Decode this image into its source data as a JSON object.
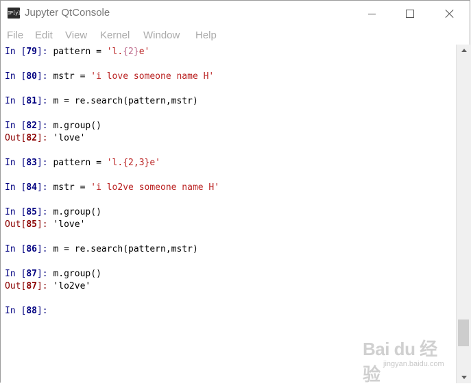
{
  "window": {
    "title": "Jupyter QtConsole",
    "icon_label": "IP[y]"
  },
  "menu": [
    "File",
    "Edit",
    "View",
    "Kernel",
    "Window",
    "Help"
  ],
  "console": [
    {
      "type": "in",
      "n": "79",
      "code": [
        {
          "t": "pattern = "
        },
        {
          "t": "'l.",
          "c": "str"
        },
        {
          "t": "{2}",
          "c": "pat"
        },
        {
          "t": "e'",
          "c": "str"
        }
      ]
    },
    {
      "type": "in",
      "n": "80",
      "code": [
        {
          "t": "mstr = "
        },
        {
          "t": "'i love someone name H'",
          "c": "str"
        }
      ]
    },
    {
      "type": "in",
      "n": "81",
      "code": [
        {
          "t": "m = re.search(pattern,mstr)"
        }
      ]
    },
    {
      "type": "in",
      "n": "82",
      "code": [
        {
          "t": "m.group()"
        }
      ]
    },
    {
      "type": "out",
      "n": "82",
      "code": [
        {
          "t": "'love'"
        }
      ]
    },
    {
      "type": "in",
      "n": "83",
      "code": [
        {
          "t": "pattern = "
        },
        {
          "t": "'l.{2,3}e'",
          "c": "str"
        }
      ]
    },
    {
      "type": "in",
      "n": "84",
      "code": [
        {
          "t": "mstr = "
        },
        {
          "t": "'i lo2ve someone name H'",
          "c": "str"
        }
      ]
    },
    {
      "type": "in",
      "n": "85",
      "code": [
        {
          "t": "m.group()"
        }
      ]
    },
    {
      "type": "out",
      "n": "85",
      "code": [
        {
          "t": "'love'"
        }
      ]
    },
    {
      "type": "in",
      "n": "86",
      "code": [
        {
          "t": "m = re.search(pattern,mstr)"
        }
      ]
    },
    {
      "type": "in",
      "n": "87",
      "code": [
        {
          "t": "m.group()"
        }
      ]
    },
    {
      "type": "out",
      "n": "87",
      "code": [
        {
          "t": "'lo2ve'"
        }
      ]
    },
    {
      "type": "in",
      "n": "88",
      "code": []
    }
  ],
  "watermark": {
    "logo": "Bai du 经验",
    "url": "jingyan.baidu.com"
  }
}
